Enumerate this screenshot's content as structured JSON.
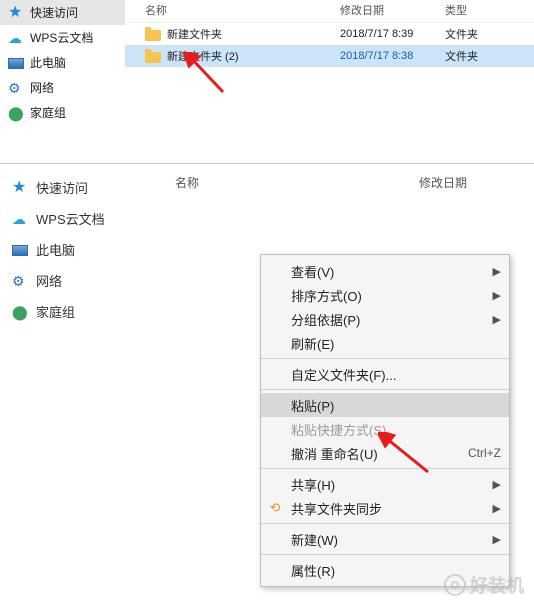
{
  "panel1": {
    "sidebar": [
      {
        "icon": "star",
        "label": "快速访问"
      },
      {
        "icon": "cloud",
        "label": "WPS云文档"
      },
      {
        "icon": "pc",
        "label": "此电脑"
      },
      {
        "icon": "net",
        "label": "网络"
      },
      {
        "icon": "home",
        "label": "家庭组"
      }
    ],
    "headers": {
      "name": "名称",
      "date": "修改日期",
      "type": "类型"
    },
    "rows": [
      {
        "name": "新建文件夹",
        "date": "2018/7/17 8:39",
        "type": "文件夹",
        "selected": false
      },
      {
        "name": "新建文件夹 (2)",
        "date": "2018/7/17 8:38",
        "type": "文件夹",
        "selected": true
      }
    ]
  },
  "panel2": {
    "sidebar": [
      {
        "icon": "star",
        "label": "快速访问"
      },
      {
        "icon": "cloud",
        "label": "WPS云文档"
      },
      {
        "icon": "pc",
        "label": "此电脑"
      },
      {
        "icon": "net",
        "label": "网络"
      },
      {
        "icon": "home",
        "label": "家庭组"
      }
    ],
    "headers": {
      "name": "名称",
      "date": "修改日期"
    },
    "menu": [
      {
        "kind": "item",
        "label": "查看(V)",
        "sub": true
      },
      {
        "kind": "item",
        "label": "排序方式(O)",
        "sub": true
      },
      {
        "kind": "item",
        "label": "分组依据(P)",
        "sub": true
      },
      {
        "kind": "item",
        "label": "刷新(E)"
      },
      {
        "kind": "sep"
      },
      {
        "kind": "item",
        "label": "自定义文件夹(F)..."
      },
      {
        "kind": "sep"
      },
      {
        "kind": "item",
        "label": "粘贴(P)",
        "hover": true
      },
      {
        "kind": "item",
        "label": "粘贴快捷方式(S)",
        "disabled": true
      },
      {
        "kind": "item",
        "label": "撤消 重命名(U)",
        "shortcut": "Ctrl+Z"
      },
      {
        "kind": "sep"
      },
      {
        "kind": "item",
        "label": "共享(H)",
        "sub": true
      },
      {
        "kind": "item",
        "label": "共享文件夹同步",
        "icon": "sync",
        "sub": true
      },
      {
        "kind": "sep"
      },
      {
        "kind": "item",
        "label": "新建(W)",
        "sub": true
      },
      {
        "kind": "sep"
      },
      {
        "kind": "item",
        "label": "属性(R)"
      }
    ]
  },
  "watermark": "好装机"
}
